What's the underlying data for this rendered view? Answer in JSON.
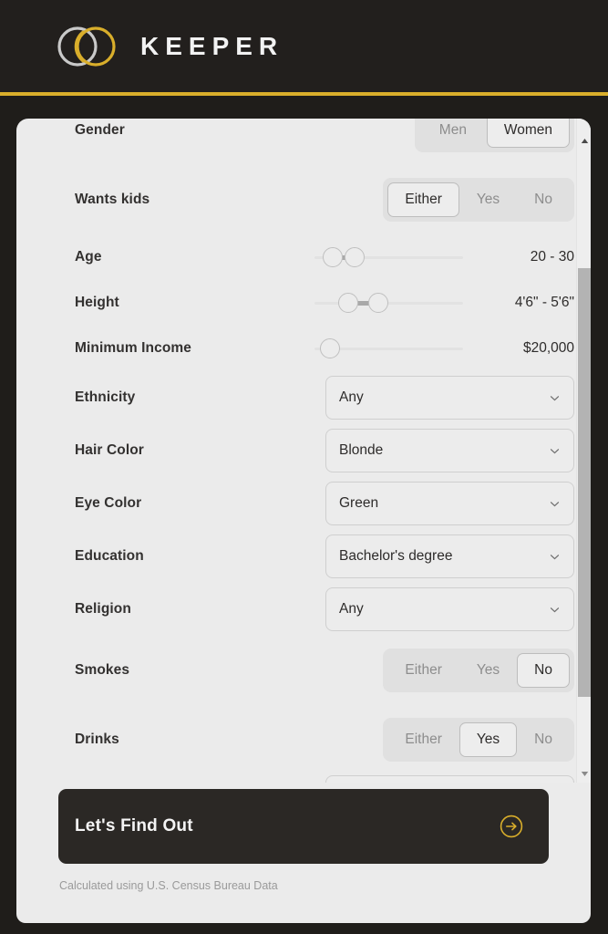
{
  "brand": {
    "wordmark": "KEEPER",
    "logo_icon": "two-interlocking-rings-icon",
    "ring_left_color": "#c9c9c9",
    "ring_right_color": "#d9ae2b",
    "accent_color": "#d9ae2b",
    "header_background": "#221f1d"
  },
  "card": {
    "background": "#ebebeb"
  },
  "form": {
    "rows": [
      {
        "label": "Gender",
        "type": "segmented",
        "options": [
          "Men",
          "Women"
        ],
        "selected": "Women"
      },
      {
        "label": "Wants kids",
        "type": "segmented",
        "options": [
          "Either",
          "Yes",
          "No"
        ],
        "selected": "Either"
      },
      {
        "label": "Age",
        "type": "range",
        "value": "20 - 30"
      },
      {
        "label": "Height",
        "type": "range",
        "value": "4'6\" - 5'6\""
      },
      {
        "label": "Minimum Income",
        "type": "single",
        "value": "$20,000"
      },
      {
        "label": "Ethnicity",
        "type": "dropdown",
        "value": "Any"
      },
      {
        "label": "Hair Color",
        "type": "dropdown",
        "value": "Blonde"
      },
      {
        "label": "Eye Color",
        "type": "dropdown",
        "value": "Green"
      },
      {
        "label": "Education",
        "type": "dropdown",
        "value": "Bachelor's degree"
      },
      {
        "label": "Religion",
        "type": "dropdown",
        "value": "Any"
      },
      {
        "label": "Smokes",
        "type": "segmented",
        "options": [
          "Either",
          "Yes",
          "No"
        ],
        "selected": "No"
      },
      {
        "label": "Drinks",
        "type": "segmented",
        "options": [
          "Either",
          "Yes",
          "No"
        ],
        "selected": "Yes"
      }
    ]
  },
  "scrollbar": {
    "up_icon": "triangle-up-icon",
    "down_icon": "triangle-down-icon",
    "thumb_color": "#b3b3b3"
  },
  "cta": {
    "label": "Let's Find Out",
    "icon": "arrow-right-circle-icon",
    "icon_color": "#d9ae2b",
    "background": "#2b2825"
  },
  "footnote": {
    "text": "Calculated using U.S. Census Bureau Data"
  }
}
